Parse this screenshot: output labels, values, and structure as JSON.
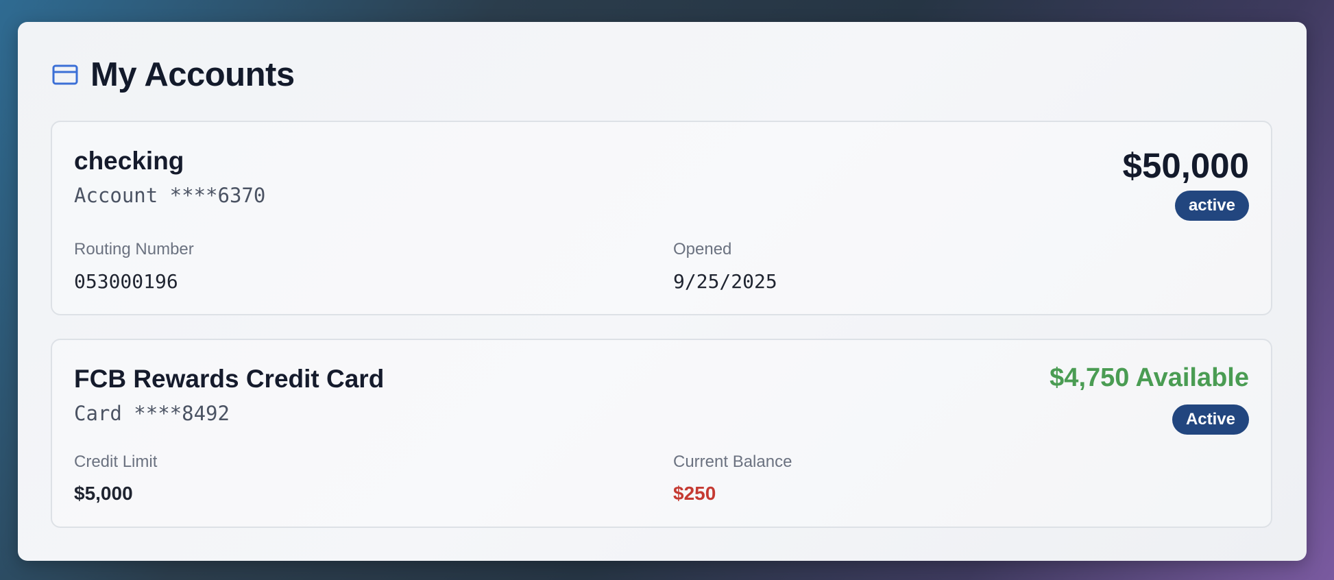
{
  "page": {
    "title": "My Accounts",
    "icon": "credit-card-icon"
  },
  "colors": {
    "accent_icon": "#3b6fd6",
    "badge_bg": "#22467f",
    "available_green": "#4a9c53",
    "balance_red": "#c53a32"
  },
  "accounts": [
    {
      "name": "checking",
      "number_masked": "Account ****6370",
      "amount": "$50,000",
      "status": "active",
      "fields": [
        {
          "label": "Routing Number",
          "value": "053000196"
        },
        {
          "label": "Opened",
          "value": "9/25/2025"
        }
      ]
    },
    {
      "name": "FCB Rewards Credit Card",
      "number_masked": "Card ****8492",
      "amount": "$4,750 Available",
      "status": "Active",
      "fields": [
        {
          "label": "Credit Limit",
          "value": "$5,000"
        },
        {
          "label": "Current Balance",
          "value": "$250"
        }
      ]
    }
  ]
}
